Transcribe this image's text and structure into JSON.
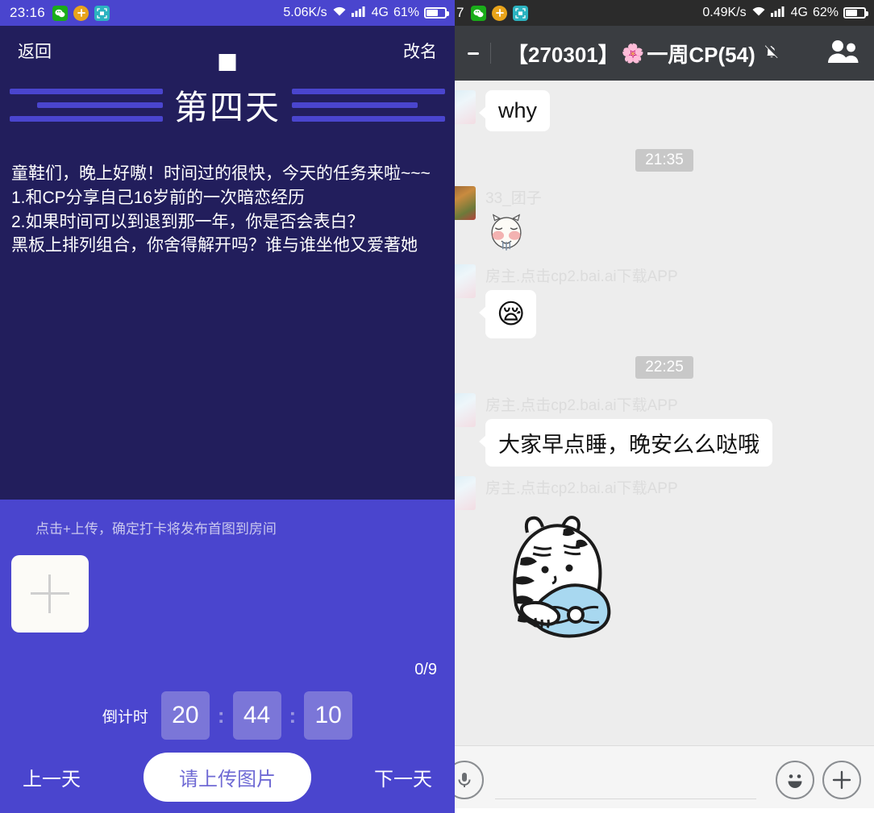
{
  "left": {
    "status_bar": {
      "time": "23:16",
      "network_speed": "5.06K/s",
      "network_type": "4G",
      "battery": "61%",
      "icons": [
        "wechat-icon",
        "plus-circle-icon",
        "scan-icon",
        "wifi-icon",
        "signal-icon",
        "battery-icon"
      ]
    },
    "header": {
      "back_label": "返回",
      "rename_label": "改名"
    },
    "day_title": "第四天",
    "task_text": "童鞋们，晚上好嗷！时间过的很快，今天的任务来啦~~~\n1.和CP分享自己16岁前的一次暗恋经历\n2.如果时间可以到退到那一年，你是否会表白？\n黑板上排列组合，你舍得解开吗？谁与谁坐他又爱著她",
    "upload": {
      "tip": "点击+上传，确定打卡将发布首图到房间",
      "counter": "0/9",
      "add_icon": "plus-icon"
    },
    "countdown": {
      "label": "倒计时",
      "hours": "20",
      "minutes": "44",
      "seconds": "10",
      "separator": ":"
    },
    "footer": {
      "prev_label": "上一天",
      "submit_label": "请上传图片",
      "next_label": "下一天"
    },
    "colors": {
      "bg_dark": "#221e5c",
      "bg_accent": "#4a45ce",
      "chip": "#7b76d8",
      "submit_text": "#6f6ad4"
    }
  },
  "right": {
    "status_bar": {
      "time": "7",
      "network_speed": "0.49K/s",
      "network_type": "4G",
      "battery": "62%",
      "icons": [
        "wechat-icon",
        "plus-circle-icon",
        "scan-icon",
        "wifi-icon",
        "signal-icon",
        "battery-icon"
      ]
    },
    "header": {
      "title_prefix": "【270301】",
      "title_flower": "🌸",
      "title_main": "一周CP(54)",
      "mute_icon": "mute-bell-icon",
      "contacts_icon": "group-members-icon"
    },
    "messages": [
      {
        "type": "text",
        "sender": "",
        "text": "why",
        "avatar": "a-girl"
      },
      {
        "type": "time",
        "text": "21:35"
      },
      {
        "type": "sticker",
        "sender": "33_团子",
        "sticker": "drooling-cat-sticker",
        "avatar": "a-warm"
      },
      {
        "type": "emoji",
        "sender": "房主.点击cp2.bai.ai下载APP",
        "text": "😪",
        "avatar": "a-girl"
      },
      {
        "type": "time",
        "text": "22:25"
      },
      {
        "type": "text",
        "sender": "房主.点击cp2.bai.ai下载APP",
        "text": "大家早点睡，晚安么么哒哦",
        "avatar": "a-girl"
      },
      {
        "type": "sticker",
        "sender": "房主.点击cp2.bai.ai下载APP",
        "sticker": "tiger-pillow-sticker",
        "avatar": "a-girl"
      }
    ],
    "input_bar": {
      "value": "",
      "placeholder": "",
      "voice_icon": "voice-icon",
      "emoji_icon": "emoji-icon",
      "more_icon": "plus-icon"
    },
    "colors": {
      "header_bg": "#3a3d41",
      "status_bg": "#2b2b2b",
      "chat_bg": "#ededed",
      "bubble_bg": "#ffffff"
    }
  }
}
